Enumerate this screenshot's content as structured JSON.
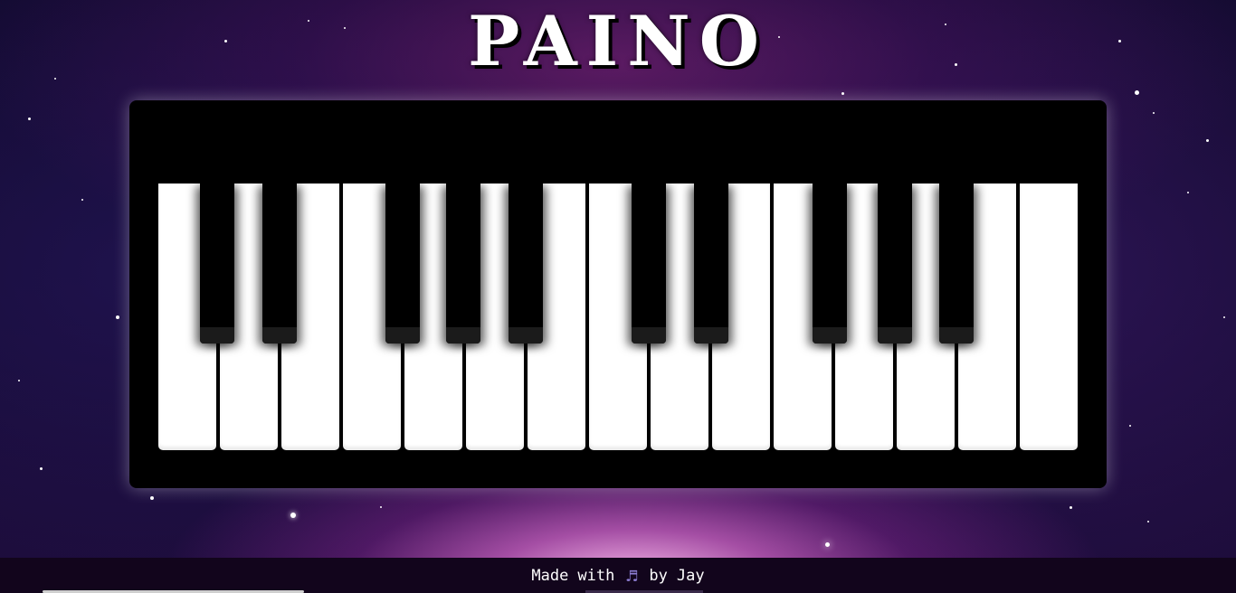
{
  "app": {
    "title": "PAINO"
  },
  "piano": {
    "white_key_count": 15,
    "black_key_count": 10
  },
  "footer": {
    "made_label": "Made",
    "with_label": "with",
    "icon": "music-notes-icon",
    "by_label": "by",
    "author": "Jay"
  },
  "colors": {
    "footer_icon": "#8f7fd6",
    "piano_body": "#000000",
    "white_key": "#ffffff",
    "black_key": "#000000"
  }
}
